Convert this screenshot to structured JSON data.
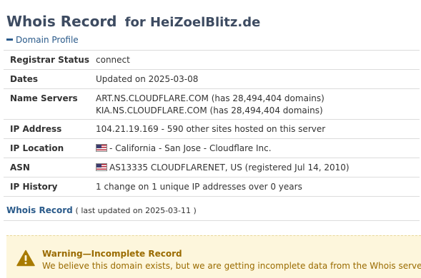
{
  "header": {
    "title": "Whois Record",
    "for_text": "for HeiZoelBlitz.de"
  },
  "domain_profile": {
    "heading": "Domain Profile",
    "rows": [
      {
        "label": "Registrar Status",
        "values": [
          "connect"
        ]
      },
      {
        "label": "Dates",
        "values": [
          "Updated on 2025-03-08"
        ]
      },
      {
        "label": "Name Servers",
        "values": [
          "ART.NS.CLOUDFLARE.COM (has 28,494,404 domains)",
          "KIA.NS.CLOUDFLARE.COM (has 28,494,404 domains)"
        ]
      },
      {
        "label": "IP Address",
        "values": [
          "104.21.19.169 - 590 other sites hosted on this server"
        ]
      },
      {
        "label": "IP Location",
        "values": [
          "- California - San Jose - Cloudflare Inc."
        ],
        "flag": "us-flag"
      },
      {
        "label": "ASN",
        "values": [
          "AS13335 CLOUDFLARENET, US (registered Jul 14, 2010)"
        ],
        "flag": "us-flag"
      },
      {
        "label": "IP History",
        "values": [
          "1 change on 1 unique IP addresses over 0 years"
        ]
      }
    ]
  },
  "whois_record": {
    "link_text": "Whois Record",
    "updated_text": "( last updated on 2025-03-11 )"
  },
  "warning": {
    "icon": "warning-triangle-icon",
    "title": "Warning—Incomplete Record",
    "text": "We believe this domain exists, but we are getting incomplete data from the Whois server."
  },
  "colors": {
    "title": "#3d4b61",
    "link": "#2a5a8a",
    "warning_bg": "#fdf6dc",
    "warning_text": "#9a6b00",
    "warning_icon": "#a87b00"
  }
}
